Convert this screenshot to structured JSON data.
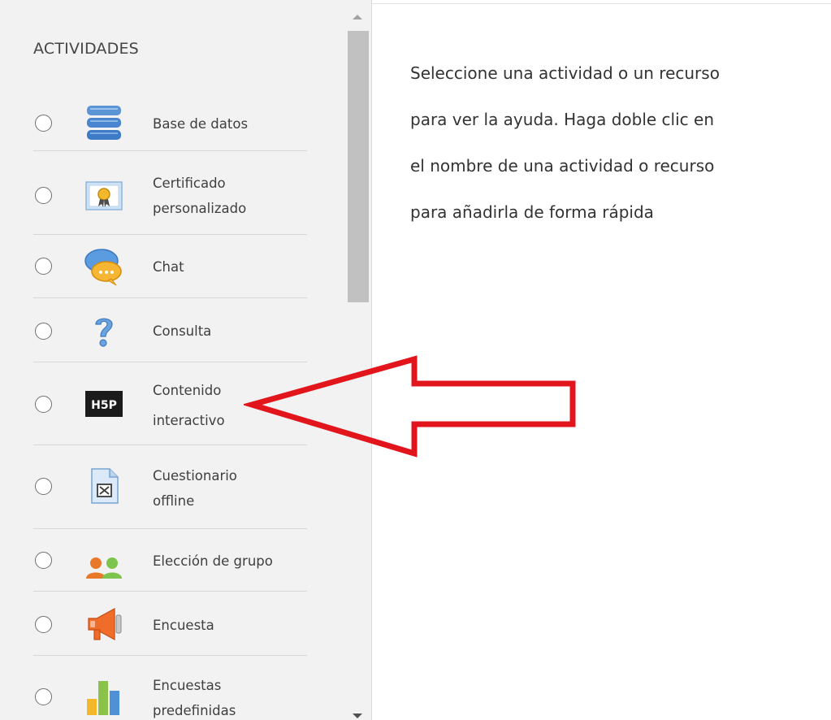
{
  "activities_panel": {
    "heading": "ACTIVIDADES",
    "items": [
      {
        "line1": "Base de datos",
        "line2": "",
        "icon": "database-icon"
      },
      {
        "line1": "Certificado",
        "line2": "personalizado",
        "icon": "certificate-icon"
      },
      {
        "line1": "Chat",
        "line2": "",
        "icon": "chat-icon"
      },
      {
        "line1": "Consulta",
        "line2": "",
        "icon": "question-icon"
      },
      {
        "line1": "Contenido",
        "line2": "interactivo",
        "icon": "h5p-icon"
      },
      {
        "line1": "Cuestionario",
        "line2": "offline",
        "icon": "offline-quiz-icon"
      },
      {
        "line1": "Elección de grupo",
        "line2": "",
        "icon": "group-choice-icon"
      },
      {
        "line1": "Encuesta",
        "line2": "",
        "icon": "megaphone-icon"
      },
      {
        "line1": "Encuestas",
        "line2": "predefinidas",
        "icon": "bar-chart-icon"
      }
    ]
  },
  "help_panel": {
    "lines": [
      "Seleccione una actividad o un recurso",
      "para ver la ayuda. Haga doble clic en",
      "el nombre de una actividad o recurso",
      "para añadirla de forma rápida"
    ]
  },
  "annotation": {
    "color": "#e3151c",
    "icon": "red-arrow-icon"
  }
}
